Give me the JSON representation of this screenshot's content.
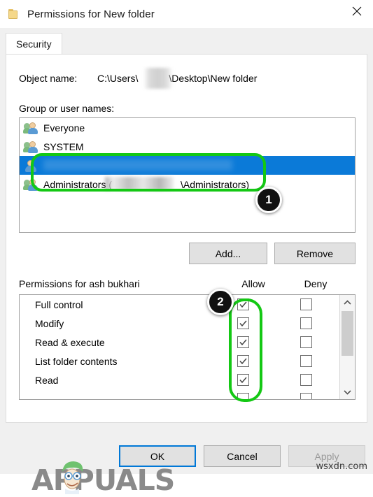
{
  "window": {
    "title": "Permissions for New folder",
    "folder_icon": "folder-icon",
    "close_icon": "close-icon"
  },
  "tabs": [
    {
      "label": "Security",
      "active": true
    }
  ],
  "object_name": {
    "label": "Object name:",
    "value": "C:\\Users\\        \\Desktop\\New folder",
    "value_prefix": "C:\\Users\\",
    "value_suffix": "\\Desktop\\New folder",
    "redacted": true
  },
  "groups": {
    "label": "Group or user names:",
    "items": [
      {
        "name": "Everyone",
        "icon": "group-icon",
        "selected": false,
        "redacted": false
      },
      {
        "name": "SYSTEM",
        "icon": "group-icon",
        "selected": false,
        "redacted": false
      },
      {
        "name": "",
        "icon": "user-icon",
        "selected": true,
        "redacted": true
      },
      {
        "name": "Administrators (            \\Administrators)",
        "icon": "group-icon",
        "selected": false,
        "redacted": true,
        "name_prefix": "Administrators (",
        "name_suffix": "\\Administrators)"
      }
    ],
    "selection_color": "#0b7ad8"
  },
  "group_buttons": {
    "add_label": "Add...",
    "remove_label": "Remove"
  },
  "permissions": {
    "label": "Permissions for ash bukhari",
    "allow_header": "Allow",
    "deny_header": "Deny",
    "rows": [
      {
        "name": "Full control",
        "allow": true,
        "deny": false
      },
      {
        "name": "Modify",
        "allow": true,
        "deny": false
      },
      {
        "name": "Read & execute",
        "allow": true,
        "deny": false
      },
      {
        "name": "List folder contents",
        "allow": true,
        "deny": false
      },
      {
        "name": "Read",
        "allow": true,
        "deny": false
      }
    ],
    "scrollbar": {
      "up_icon": "chevron-up-icon",
      "down_icon": "chevron-down-icon",
      "thumb": "scrollbar-thumb"
    }
  },
  "annotations": [
    {
      "id": "1",
      "target": "group-user-selected-rows",
      "color": "#14c814"
    },
    {
      "id": "2",
      "target": "allow-checkbox-column",
      "color": "#14c814"
    }
  ],
  "footer": {
    "ok_label": "OK",
    "cancel_label": "Cancel",
    "apply_label": "Apply",
    "apply_enabled": false,
    "focus_color": "#0078d7"
  },
  "watermarks": {
    "brand": "APPUALS",
    "site": "wsxdn.com"
  }
}
